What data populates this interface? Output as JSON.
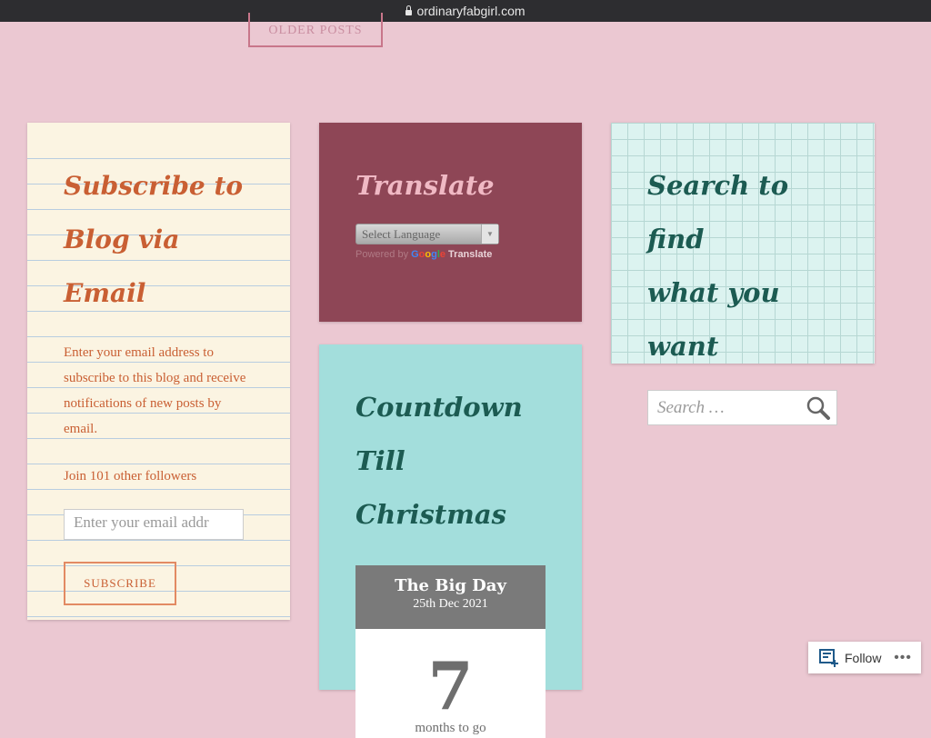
{
  "browser": {
    "url": "ordinaryfabgirl.com"
  },
  "nav": {
    "older_posts": "OLDER POSTS"
  },
  "subscribe": {
    "title_line1": "Subscribe to",
    "title_line2": "Blog via Email",
    "description": "Enter your email address to subscribe to this blog and receive notifications of new posts by email.",
    "followers": "Join 101 other followers",
    "email_placeholder": "Enter your email addr",
    "button": "SUBSCRIBE"
  },
  "translate": {
    "title": "Translate",
    "select_value": "Select Language",
    "powered_by": "Powered by",
    "google": "Google",
    "translate_link": "Translate"
  },
  "countdown": {
    "title_line1": "Countdown Till",
    "title_line2": "Christmas",
    "event": "The Big Day",
    "date": "25th Dec 2021",
    "value": "7",
    "unit": "months to go"
  },
  "search": {
    "title_line1": "Search to find",
    "title_line2": "what you want",
    "placeholder": "Search …",
    "icon": "search-icon"
  },
  "follow": {
    "label": "Follow",
    "more": "•••"
  }
}
